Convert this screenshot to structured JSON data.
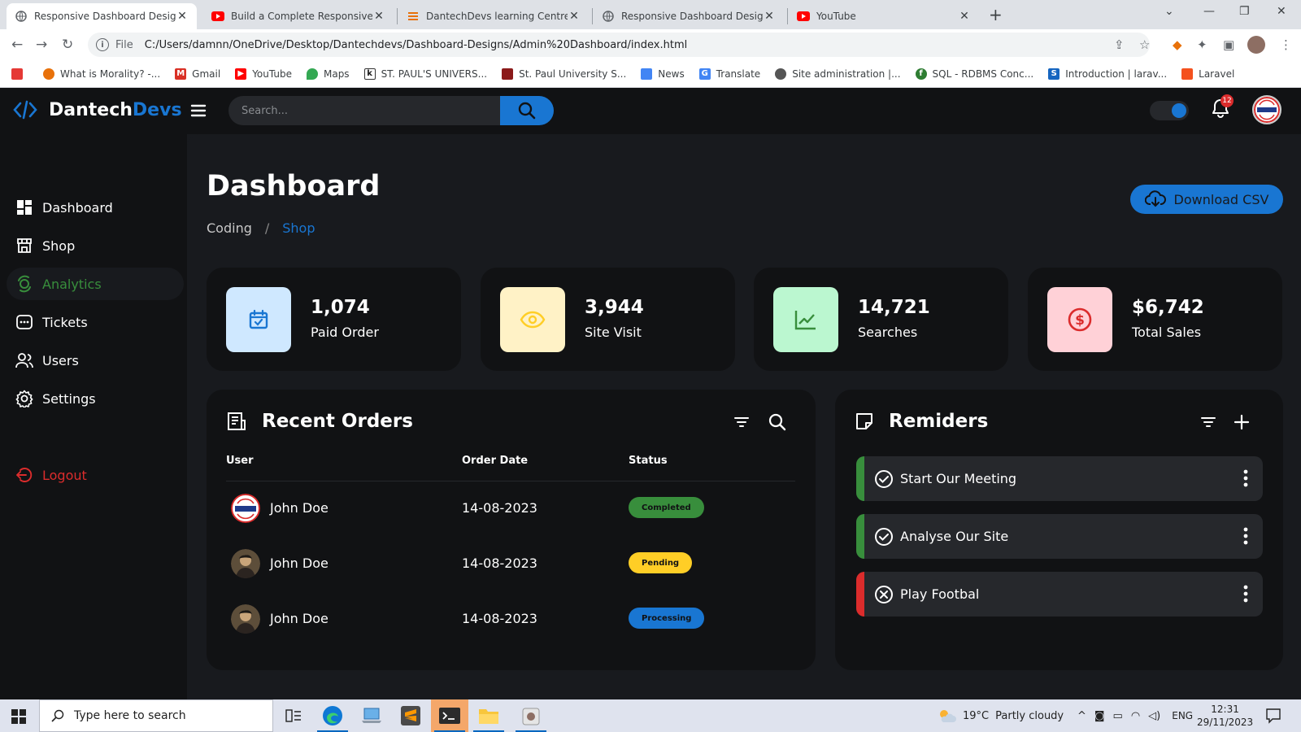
{
  "browser": {
    "tabs": [
      {
        "title": "Responsive Dashboard Design | D",
        "favicon": "globe-icon",
        "active": true
      },
      {
        "title": "Build a Complete Responsive Pe",
        "favicon": "youtube-icon",
        "active": false
      },
      {
        "title": "DantechDevs learning Centre",
        "favicon": "stack-icon",
        "active": false
      },
      {
        "title": "Responsive Dashboard Design | D",
        "favicon": "globe-icon",
        "active": false
      },
      {
        "title": "YouTube",
        "favicon": "youtube-icon",
        "active": false
      }
    ],
    "address": {
      "scheme": "File",
      "url": "C:/Users/damnn/OneDrive/Desktop/Dantechdevs/Dashboard-Designs/Admin%20Dashboard/index.html"
    },
    "bookmarks": [
      {
        "label": "What is Morality? -...",
        "icon": "morality-icon",
        "color": "#e8710a"
      },
      {
        "label": "Gmail",
        "icon": "gmail-icon",
        "color": "#d93025"
      },
      {
        "label": "YouTube",
        "icon": "youtube-icon",
        "color": "#ff0000"
      },
      {
        "label": "Maps",
        "icon": "maps-icon",
        "color": "#34a853"
      },
      {
        "label": "ST. PAUL'S UNIVERS...",
        "icon": "spu-icon",
        "color": "#1a1a1a"
      },
      {
        "label": "St. Paul University S...",
        "icon": "spu-shield-icon",
        "color": "#8b1a1a"
      },
      {
        "label": "News",
        "icon": "news-icon",
        "color": "#4285f4"
      },
      {
        "label": "Translate",
        "icon": "translate-icon",
        "color": "#4285f4"
      },
      {
        "label": "Site administration |...",
        "icon": "moodle-icon",
        "color": "#555555"
      },
      {
        "label": "SQL - RDBMS Conc...",
        "icon": "sql-icon",
        "color": "#2e7d32"
      },
      {
        "label": "Introduction | larav...",
        "icon": "laravel-s-icon",
        "color": "#1565c0"
      },
      {
        "label": "Laravel",
        "icon": "laravel-icon",
        "color": "#f4511e"
      }
    ]
  },
  "app": {
    "brand": {
      "part1": "Dantech",
      "part2": "Devs"
    },
    "search": {
      "placeholder": "Search..."
    },
    "notifications": {
      "count": "12"
    },
    "sidebar": {
      "items": [
        {
          "label": "Dashboard",
          "icon": "dashboard-icon",
          "active": false
        },
        {
          "label": "Shop",
          "icon": "shop-icon",
          "active": false
        },
        {
          "label": "Analytics",
          "icon": "analytics-icon",
          "active": true
        },
        {
          "label": "Tickets",
          "icon": "tickets-icon",
          "active": false
        },
        {
          "label": "Users",
          "icon": "users-icon",
          "active": false
        },
        {
          "label": "Settings",
          "icon": "settings-icon",
          "active": false
        }
      ],
      "logout": "Logout"
    },
    "header": {
      "title": "Dashboard",
      "breadcrumb": [
        "Coding",
        "/",
        "Shop"
      ],
      "download_label": "Download CSV"
    },
    "stats": [
      {
        "value": "1,074",
        "label": "Paid Order",
        "icon": "calendar-check-icon",
        "bg": "#cfe8ff",
        "fg": "#1976d2"
      },
      {
        "value": "3,944",
        "label": "Site Visit",
        "icon": "eye-icon",
        "bg": "#fff2c6",
        "fg": "#ffce26"
      },
      {
        "value": "14,721",
        "label": "Searches",
        "icon": "line-chart-icon",
        "bg": "#bbf7d0",
        "fg": "#388e3c"
      },
      {
        "value": "$6,742",
        "label": "Total Sales",
        "icon": "dollar-circle-icon",
        "bg": "#ffd1d7",
        "fg": "#db2c2c"
      }
    ],
    "orders": {
      "title": "Recent Orders",
      "columns": [
        "User",
        "Order Date",
        "Status"
      ],
      "rows": [
        {
          "user": "John Doe",
          "date": "14-08-2023",
          "status": "Completed",
          "status_bg": "#388e3c",
          "status_fg": "#111214",
          "avatar": "logo"
        },
        {
          "user": "John Doe",
          "date": "14-08-2023",
          "status": "Pending",
          "status_bg": "#ffce26",
          "status_fg": "#111214",
          "avatar": "photo"
        },
        {
          "user": "John Doe",
          "date": "14-08-2023",
          "status": "Processing",
          "status_bg": "#1976d2",
          "status_fg": "#111214",
          "avatar": "photo"
        }
      ]
    },
    "reminders": {
      "title": "Remiders",
      "items": [
        {
          "text": "Start Our Meeting",
          "state": "completed",
          "color": "#388e3c"
        },
        {
          "text": "Analyse Our Site",
          "state": "completed",
          "color": "#388e3c"
        },
        {
          "text": "Play Footbal",
          "state": "not-completed",
          "color": "#db2c2c"
        }
      ]
    },
    "colors": {
      "primary": "#1976d2",
      "success": "#388e3c",
      "danger": "#db2c2c",
      "warning": "#ffce26"
    }
  },
  "taskbar": {
    "search_placeholder": "Type here to search",
    "weather": {
      "temp": "19°C",
      "desc": "Partly cloudy"
    },
    "lang": "ENG",
    "time": "12:31",
    "date": "29/11/2023"
  }
}
